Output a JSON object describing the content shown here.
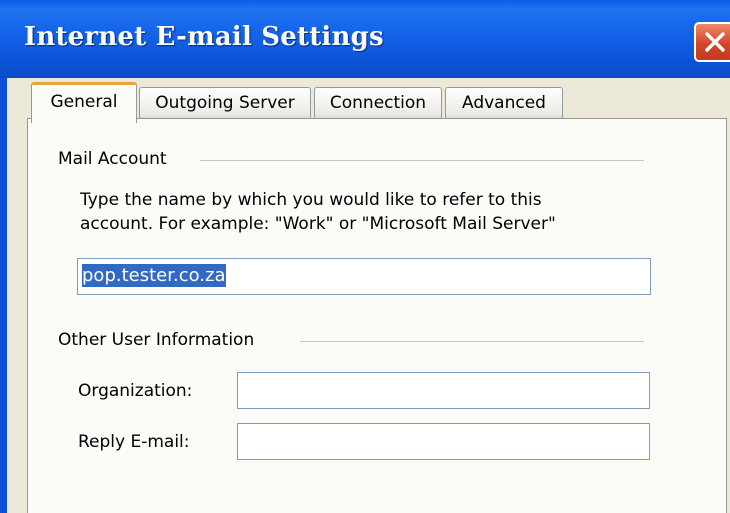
{
  "window": {
    "title": "Internet E-mail Settings"
  },
  "tabs": [
    {
      "label": "General",
      "active": true
    },
    {
      "label": "Outgoing Server",
      "active": false
    },
    {
      "label": "Connection",
      "active": false
    },
    {
      "label": "Advanced",
      "active": false
    }
  ],
  "mail_account": {
    "group_label": "Mail Account",
    "description_line1": "Type the name by which you would like to refer to this",
    "description_line2": "account.  For example: \"Work\" or \"Microsoft Mail Server\"",
    "account_name_value": "pop.tester.co.za",
    "account_name_selected": true
  },
  "other_user_info": {
    "group_label": "Other User Information",
    "organization_label": "Organization:",
    "organization_value": "",
    "reply_email_label": "Reply E-mail:",
    "reply_email_value": ""
  },
  "colors": {
    "titlebar": "#0b53d6",
    "dialog_face": "#ece9d8",
    "active_tab_accent": "#e8a23c",
    "close_button": "#d2472a",
    "selection": "#316ac5"
  },
  "icons": {
    "close": "close-icon"
  }
}
